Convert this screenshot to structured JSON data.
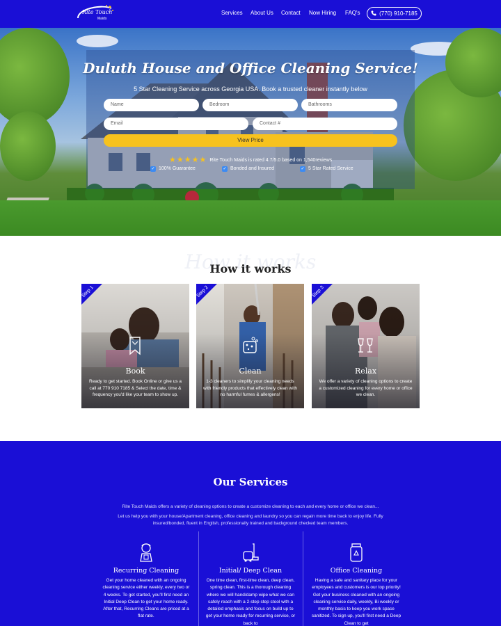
{
  "nav": {
    "logo_text": "Rite Touch",
    "logo_sub": "Maids",
    "links": [
      "Services",
      "About Us",
      "Contact",
      "Now Hiring",
      "FAQ's"
    ],
    "phone": "(770) 910-7185"
  },
  "hero": {
    "title": "Duluth House and Office Cleaning Service!",
    "subtitle": "5 Star Cleaning Service across Georgia USA. Book a trusted cleaner instantly below",
    "placeholders": {
      "name": "Name",
      "bedroom": "Bedroom",
      "bathrooms": "Bathrooms",
      "email": "Email",
      "contact": "Contact #"
    },
    "view_price": "View Price",
    "rating_text": "Rite Touch Maids is rated 4.7/5.0 based on 1,540reviews",
    "stars": 5,
    "features": [
      "100% Guarantee",
      "Bonded and Insured",
      "5 Star Rated Service"
    ]
  },
  "how": {
    "ghost": "How it works",
    "title": "How it works",
    "cards": [
      {
        "step": "Step 1",
        "label": "Book",
        "icon": "bookmark-icon",
        "desc": "Ready to get started. Book Online or give us a call at 770 910 7185 & Select the date, time & frequency you'd like your team to show up."
      },
      {
        "step": "Step 2",
        "label": "Clean",
        "icon": "sponge-icon",
        "desc": "1-3 cleaners to simplify your cleaning needs with friendly products that effectively clean with no harmful fumes & allergens!"
      },
      {
        "step": "Step 3",
        "label": "Relax",
        "icon": "wine-glasses-icon",
        "desc": "We offer a variety of cleaning options to create a customized cleaning for every home or office we clean."
      }
    ]
  },
  "services": {
    "title": "Our Services",
    "intro1": "Rite Touch Maids offers a variety of cleaning options to create a customize cleaning to each and every home or office we clean...",
    "intro2": "Let us help you with your house/Apartment cleaning, office cleaning and laundry so you can regain more time back to enjoy life. Fully insured/bonded, fluent in English, professionally trained and background checked team members.",
    "items": [
      {
        "name": "Recurring Cleaning",
        "icon": "maid-icon",
        "desc": "Get your home cleaned with an ongoing cleaning service either weekly, every two or 4 weeks. To get started, you'll first need an Initial Deep Clean to get your home ready. After that, Recurring Cleans are priced at a flat rate."
      },
      {
        "name": "Initial/ Deep Clean",
        "icon": "vacuum-icon",
        "desc": "One time clean, first-time clean, deep clean, spring clean. This is a thorough cleaning where we will hand/damp wipe what we can safely reach with a 2-step step stool with a detailed emphasis and focus on build up to get your home ready for recurring service, or back to"
      },
      {
        "name": "Office Cleaning",
        "icon": "spray-bottle-icon",
        "desc": "Having a safe and sanitary place for your employees and customers is our top priority! Get your business cleaned with an ongoing cleaning service daily, weekly, Bi weekly or monthly basis to keep you work space sanitized. To sign up, you'll first need a Deep Clean to get"
      }
    ]
  },
  "colors": {
    "brand": "#1a0fd6",
    "accent": "#f7c21e",
    "check": "#3d8bf2"
  }
}
